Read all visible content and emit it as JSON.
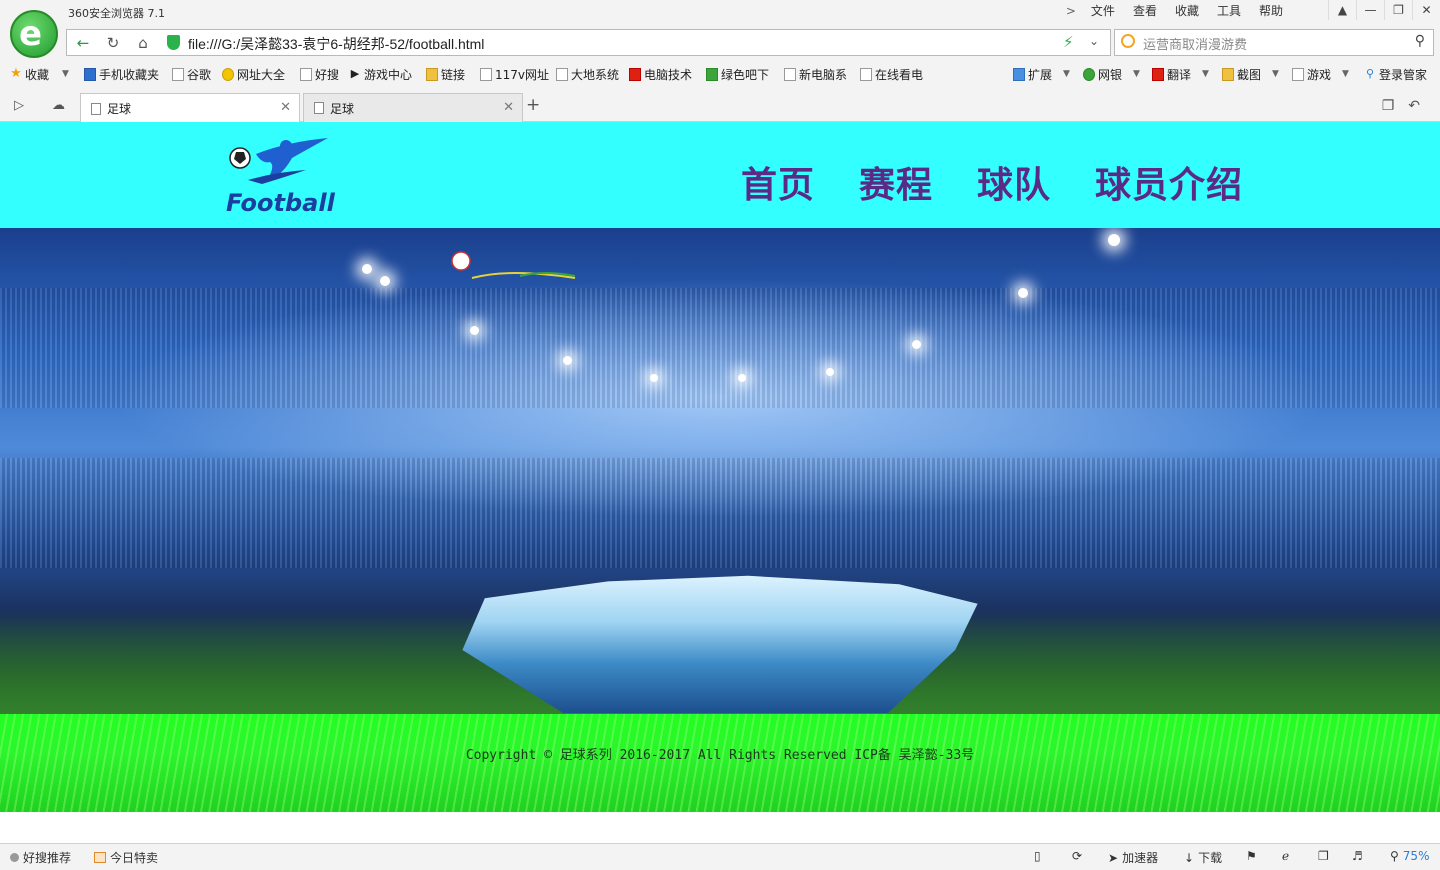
{
  "browser": {
    "title": "360安全浏览器 7.1",
    "menus": [
      "文件",
      "查看",
      "收藏",
      "工具",
      "帮助"
    ],
    "url": "file:///G:/吴泽懿33-袁宁6-胡经邦-52/football.html",
    "search_placeholder": "运营商取消漫游费",
    "bookmarks": [
      "收藏",
      "手机收藏夹",
      "谷歌",
      "网址大全",
      "好搜",
      "游戏中心",
      "链接",
      "117v网址",
      "大地系统",
      "电脑技术",
      "绿色吧下",
      "新电脑系",
      "在线看电"
    ],
    "tools": [
      "扩展",
      "网银",
      "翻译",
      "截图",
      "游戏",
      "登录管家"
    ],
    "tabs": [
      {
        "title": "足球",
        "active": true
      },
      {
        "title": "足球",
        "active": false
      }
    ]
  },
  "site": {
    "logo_text": "Football",
    "nav": [
      "首页",
      "赛程",
      "球队",
      "球员介绍"
    ],
    "footer_text": "Copyright © 足球系列 2016-2017 All Rights Reserved ICP备 吴泽懿-33号",
    "colors": {
      "header_bg": "#33ffff",
      "nav_text": "#5b2a86",
      "footer_bg": "#22ff22"
    }
  },
  "status": {
    "left": [
      "好搜推荐",
      "今日特卖"
    ],
    "right": [
      "加速器",
      "下载"
    ],
    "zoom": "75%"
  }
}
